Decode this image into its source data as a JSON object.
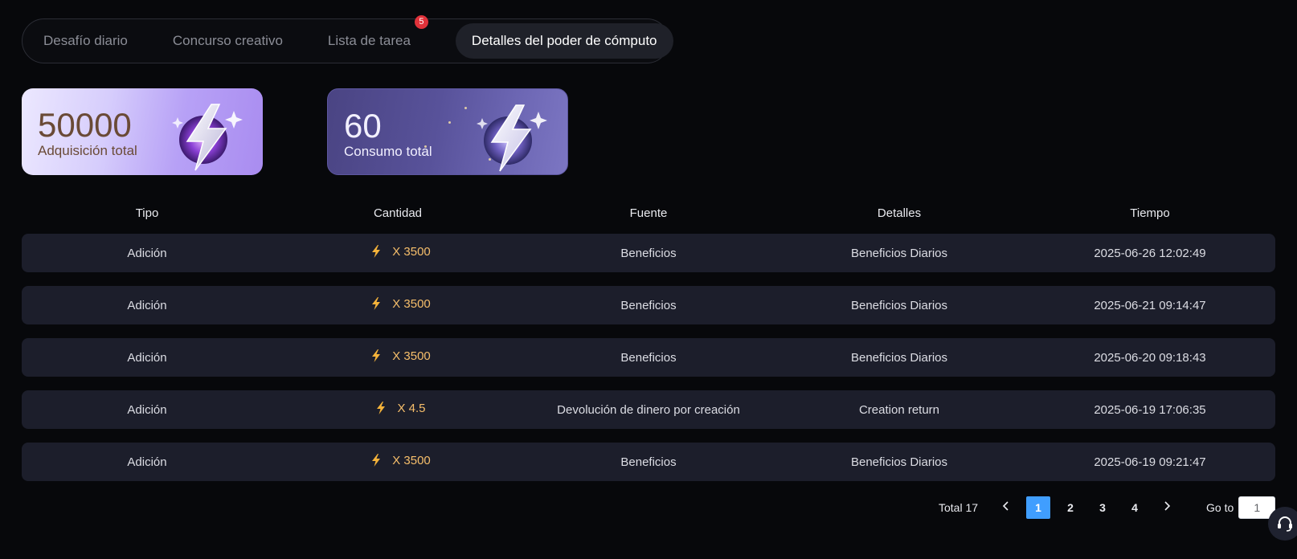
{
  "tabs": [
    {
      "label": "Desafío diario"
    },
    {
      "label": "Concurso creativo"
    },
    {
      "label": "Lista de tarea",
      "badge": "5"
    },
    {
      "label": "Detalles del poder de cómputo",
      "active": true
    }
  ],
  "stats": {
    "acquisition": {
      "value": "50000",
      "label": "Adquisición total"
    },
    "consumption": {
      "value": "60",
      "label": "Consumo total"
    }
  },
  "table": {
    "headers": [
      "Tipo",
      "Cantidad",
      "Fuente",
      "Detalles",
      "Tiempo"
    ],
    "rows": [
      {
        "type": "Adición",
        "amount": "X 3500",
        "source": "Beneficios",
        "details": "Beneficios Diarios",
        "time": "2025-06-26 12:02:49"
      },
      {
        "type": "Adición",
        "amount": "X 3500",
        "source": "Beneficios",
        "details": "Beneficios Diarios",
        "time": "2025-06-21 09:14:47"
      },
      {
        "type": "Adición",
        "amount": "X 3500",
        "source": "Beneficios",
        "details": "Beneficios Diarios",
        "time": "2025-06-20 09:18:43"
      },
      {
        "type": "Adición",
        "amount": "X 4.5",
        "source": "Devolución de dinero por creación",
        "details": "Creation return",
        "time": "2025-06-19 17:06:35"
      },
      {
        "type": "Adición",
        "amount": "X 3500",
        "source": "Beneficios",
        "details": "Beneficios Diarios",
        "time": "2025-06-19 09:21:47"
      }
    ]
  },
  "pagination": {
    "total": "Total 17",
    "pages": [
      "1",
      "2",
      "3",
      "4"
    ],
    "current": "1",
    "goto_label": "Go to",
    "goto_value": "1"
  },
  "icons": {
    "amount_icon": "lightning-icon",
    "support_icon": "headset-icon"
  },
  "colors": {
    "accent": "#409eff",
    "amount": "#f7bf6b",
    "badge": "#e0323a",
    "row_bg": "#1c1e2b"
  }
}
